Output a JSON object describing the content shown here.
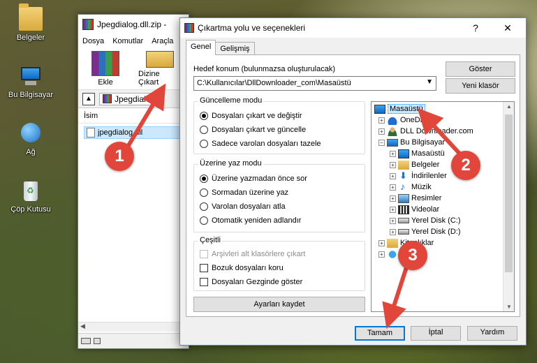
{
  "desktop": {
    "icons": [
      {
        "label": "Belgeler",
        "icon": "folder-icon"
      },
      {
        "label": "Bu Bilgisayar",
        "icon": "computer-icon"
      },
      {
        "label": "Ağ",
        "icon": "network-icon"
      },
      {
        "label": "Çöp Kutusu",
        "icon": "recycle-bin-icon"
      }
    ]
  },
  "winrar": {
    "title": "Jpegdialog.dll.zip -",
    "menu": [
      "Dosya",
      "Komutlar",
      "Araçla"
    ],
    "tools": {
      "add": "Ekle",
      "extract": "Dizine Çıkart"
    },
    "address": "Jpegdialog",
    "column_name": "İsim",
    "file": "jpegdialog.dll"
  },
  "dialog": {
    "title": "Çıkartma yolu ve seçenekleri",
    "help_glyph": "?",
    "close_glyph": "✕",
    "tabs": [
      "Genel",
      "Gelişmiş"
    ],
    "dest_label": "Hedef konum (bulunmazsa oluşturulacak)",
    "dest_value": "C:\\Kullanıcılar\\DllDownloader_com\\Masaüstü",
    "show_button": "Göster",
    "new_folder_button": "Yeni klasör",
    "update_group": {
      "title": "Güncelleme modu",
      "options": [
        {
          "label": "Dosyaları çıkart ve değiştir",
          "selected": true
        },
        {
          "label": "Dosyaları çıkart ve güncelle",
          "selected": false
        },
        {
          "label": "Sadece varolan dosyaları tazele",
          "selected": false
        }
      ]
    },
    "overwrite_group": {
      "title": "Üzerine yaz modu",
      "options": [
        {
          "label": "Üzerine yazmadan önce sor",
          "selected": true
        },
        {
          "label": "Sormadan üzerine yaz",
          "selected": false
        },
        {
          "label": "Varolan dosyaları atla",
          "selected": false
        },
        {
          "label": "Otomatik yeniden adlandır",
          "selected": false
        }
      ]
    },
    "misc_group": {
      "title": "Çeşitli",
      "options": [
        {
          "label": "Arşivleri alt klasörlere çıkart",
          "checked": false,
          "disabled": true
        },
        {
          "label": "Bozuk dosyaları koru",
          "checked": false,
          "disabled": false
        },
        {
          "label": "Dosyaları Gezginde göster",
          "checked": false,
          "disabled": false
        }
      ]
    },
    "save_settings": "Ayarları kaydet",
    "tree": [
      {
        "label": "Masaüstü",
        "icon": "desktop-icon",
        "selected": true
      },
      {
        "label": "OneDrive",
        "icon": "onedrive-icon"
      },
      {
        "label": "DLL Downloader.com",
        "icon": "user-folder-icon"
      },
      {
        "label": "Bu Bilgisayar",
        "icon": "computer-icon"
      },
      {
        "label": "Masaüstü",
        "icon": "desktop-icon"
      },
      {
        "label": "Belgeler",
        "icon": "documents-icon"
      },
      {
        "label": "İndirilenler",
        "icon": "downloads-icon"
      },
      {
        "label": "Müzik",
        "icon": "music-icon"
      },
      {
        "label": "Resimler",
        "icon": "pictures-icon"
      },
      {
        "label": "Videolar",
        "icon": "videos-icon"
      },
      {
        "label": "Yerel Disk (C:)",
        "icon": "disk-icon"
      },
      {
        "label": "Yerel Disk (D:)",
        "icon": "disk-icon"
      },
      {
        "label": "Kitaplıklar",
        "icon": "libraries-icon"
      },
      {
        "label": "Ağ",
        "icon": "network-icon"
      }
    ],
    "buttons": {
      "ok": "Tamam",
      "cancel": "İptal",
      "help": "Yardım"
    }
  },
  "annotations": [
    "1",
    "2",
    "3"
  ],
  "colors": {
    "annotation": "#e2463a",
    "selection": "#cce8ff",
    "focus": "#0078d7"
  }
}
